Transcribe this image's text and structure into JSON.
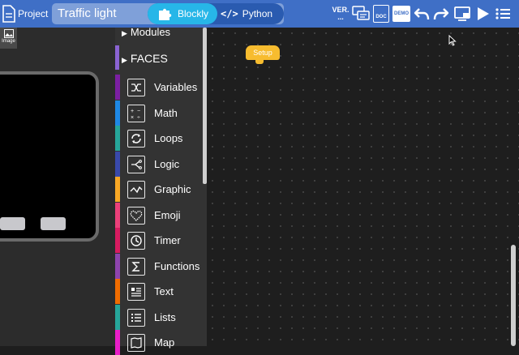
{
  "topbar": {
    "project_label": "Project",
    "title": "Traffic light",
    "mode_blockly": "Blockly",
    "mode_python": "Python",
    "python_icon_glyph": "</>",
    "ver_line1": "VER.",
    "ver_line2": "...",
    "doc_label": "DOC",
    "demo_label": "DEMO",
    "icons": [
      "version-icon",
      "chat-icon",
      "doc-icon",
      "demo-icon",
      "undo-icon",
      "redo-icon",
      "device-icon",
      "run-icon",
      "menu-icon"
    ],
    "bar_color": "#3f6fc6",
    "active_color": "#27b6e8"
  },
  "simulator": {
    "image_tab_label": "Image",
    "buttons": [
      "button-a",
      "button-b"
    ]
  },
  "categories": {
    "groups": [
      {
        "label": "Modules",
        "collapsed": true
      },
      {
        "label": "FACES",
        "collapsed": true,
        "color": "#8a63d2"
      }
    ],
    "items": [
      {
        "label": "Variables",
        "color": "#7b1fa2",
        "icon": "variables-icon"
      },
      {
        "label": "Math",
        "color": "#1e88e5",
        "icon": "math-icon"
      },
      {
        "label": "Loops",
        "color": "#26a69a",
        "icon": "loops-icon"
      },
      {
        "label": "Logic",
        "color": "#3949ab",
        "icon": "logic-icon"
      },
      {
        "label": "Graphic",
        "color": "#f9a825",
        "icon": "graphic-icon"
      },
      {
        "label": "Emoji",
        "color": "#ec407a",
        "icon": "emoji-icon"
      },
      {
        "label": "Timer",
        "color": "#d81b60",
        "icon": "timer-icon"
      },
      {
        "label": "Functions",
        "color": "#8e44ad",
        "icon": "functions-icon"
      },
      {
        "label": "Text",
        "color": "#ef6c00",
        "icon": "text-icon"
      },
      {
        "label": "Lists",
        "color": "#26a69a",
        "icon": "lists-icon"
      },
      {
        "label": "Map",
        "color": "#e91ec8",
        "icon": "map-icon"
      }
    ]
  },
  "workspace": {
    "setup_block": "Setup",
    "setup_color": "#f7bc2f"
  }
}
